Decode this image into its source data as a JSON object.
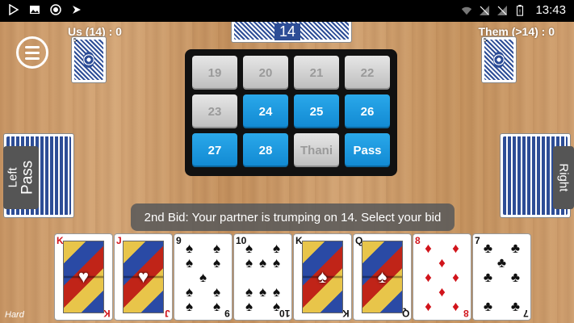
{
  "status_bar": {
    "time": "13:43",
    "left_icons": [
      "play-store-icon",
      "image-icon",
      "record-icon",
      "app-icon"
    ],
    "right_icons": [
      "wifi-icon",
      "no-signal-icon",
      "no-signal-icon",
      "battery-icon"
    ]
  },
  "scores": {
    "us": "Us (14) : 0",
    "them": "Them (>14) : 0"
  },
  "top_player": {
    "bid": "14"
  },
  "mini_card_rank": "5",
  "left_player": {
    "name": "Left",
    "status": "Pass"
  },
  "right_player": {
    "name": "Right",
    "status": ""
  },
  "bid_options": [
    {
      "label": "19",
      "enabled": false
    },
    {
      "label": "20",
      "enabled": false
    },
    {
      "label": "21",
      "enabled": false
    },
    {
      "label": "22",
      "enabled": false
    },
    {
      "label": "23",
      "enabled": false
    },
    {
      "label": "24",
      "enabled": true
    },
    {
      "label": "25",
      "enabled": true
    },
    {
      "label": "26",
      "enabled": true
    },
    {
      "label": "27",
      "enabled": true
    },
    {
      "label": "28",
      "enabled": true
    },
    {
      "label": "Thani",
      "enabled": false
    },
    {
      "label": "Pass",
      "enabled": true
    }
  ],
  "message": "2nd Bid: Your partner is trumping on 14. Select your bid",
  "hand": [
    {
      "rank": "K",
      "suit": "♥",
      "color": "red",
      "face": true
    },
    {
      "rank": "J",
      "suit": "♥",
      "color": "red",
      "face": true
    },
    {
      "rank": "9",
      "suit": "♠",
      "color": "blk",
      "face": false
    },
    {
      "rank": "10",
      "suit": "♠",
      "color": "blk",
      "face": false
    },
    {
      "rank": "K",
      "suit": "♠",
      "color": "blk",
      "face": true
    },
    {
      "rank": "Q",
      "suit": "♠",
      "color": "blk",
      "face": true
    },
    {
      "rank": "8",
      "suit": "♦",
      "color": "red",
      "face": false
    },
    {
      "rank": "7",
      "suit": "♣",
      "color": "blk",
      "face": false
    }
  ],
  "difficulty": "Hard",
  "colors": {
    "bid_active": "#1a97df",
    "bid_disabled": "#cfcfcf",
    "card_back": "#2d4d96"
  }
}
